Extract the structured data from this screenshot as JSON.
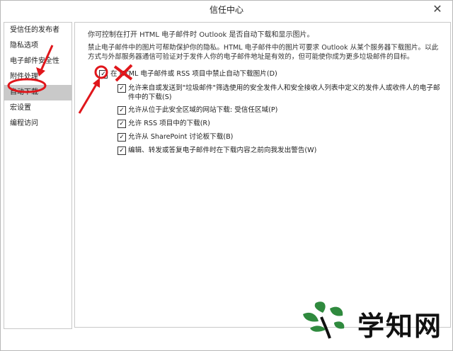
{
  "window": {
    "title": "信任中心",
    "close_glyph": "✕"
  },
  "sidebar": {
    "items": [
      {
        "label": "受信任的发布者"
      },
      {
        "label": "隐私选项"
      },
      {
        "label": "电子邮件安全性"
      },
      {
        "label": "附件处理"
      },
      {
        "label": "自动下载",
        "selected": true
      },
      {
        "label": "宏设置"
      },
      {
        "label": "编程访问"
      }
    ]
  },
  "content": {
    "intro": "你可控制在打开 HTML 电子邮件时 Outlook 是否自动下载和显示图片。",
    "description": "禁止电子邮件中的图片可帮助保护你的隐私。HTML 电子邮件中的图片可要求 Outlook 从某个服务器下载图片。以此方式与外部服务器通信可验证对于发件人你的电子邮件地址是有效的，但可能使你成为更多垃圾邮件的目标。",
    "main_option": {
      "label": "在 HTML 电子邮件或 RSS 项目中禁止自动下载图片(D)",
      "checked": true
    },
    "sub_options": [
      {
        "label": "允许来自或发送到\"垃圾邮件\"筛选使用的安全发件人和安全接收人列表中定义的发件人或收件人的电子邮件中的下载(S)",
        "checked": true
      },
      {
        "label": "允许从位于此安全区域的网站下载: 受信任区域(P)",
        "checked": true
      },
      {
        "label": "允许 RSS 项目中的下载(R)",
        "checked": true
      },
      {
        "label": "允许从 SharePoint 讨论板下载(B)",
        "checked": true
      },
      {
        "label": "编辑、转发或答复电子邮件时在下载内容之前向我发出警告(W)",
        "checked": true
      }
    ]
  },
  "check_glyph": "✓",
  "watermark": {
    "text": "学知网"
  },
  "colors": {
    "annotation_red": "#e0161b",
    "selected_bg": "#c9c9c9",
    "logo_green": "#2f8a3e"
  }
}
